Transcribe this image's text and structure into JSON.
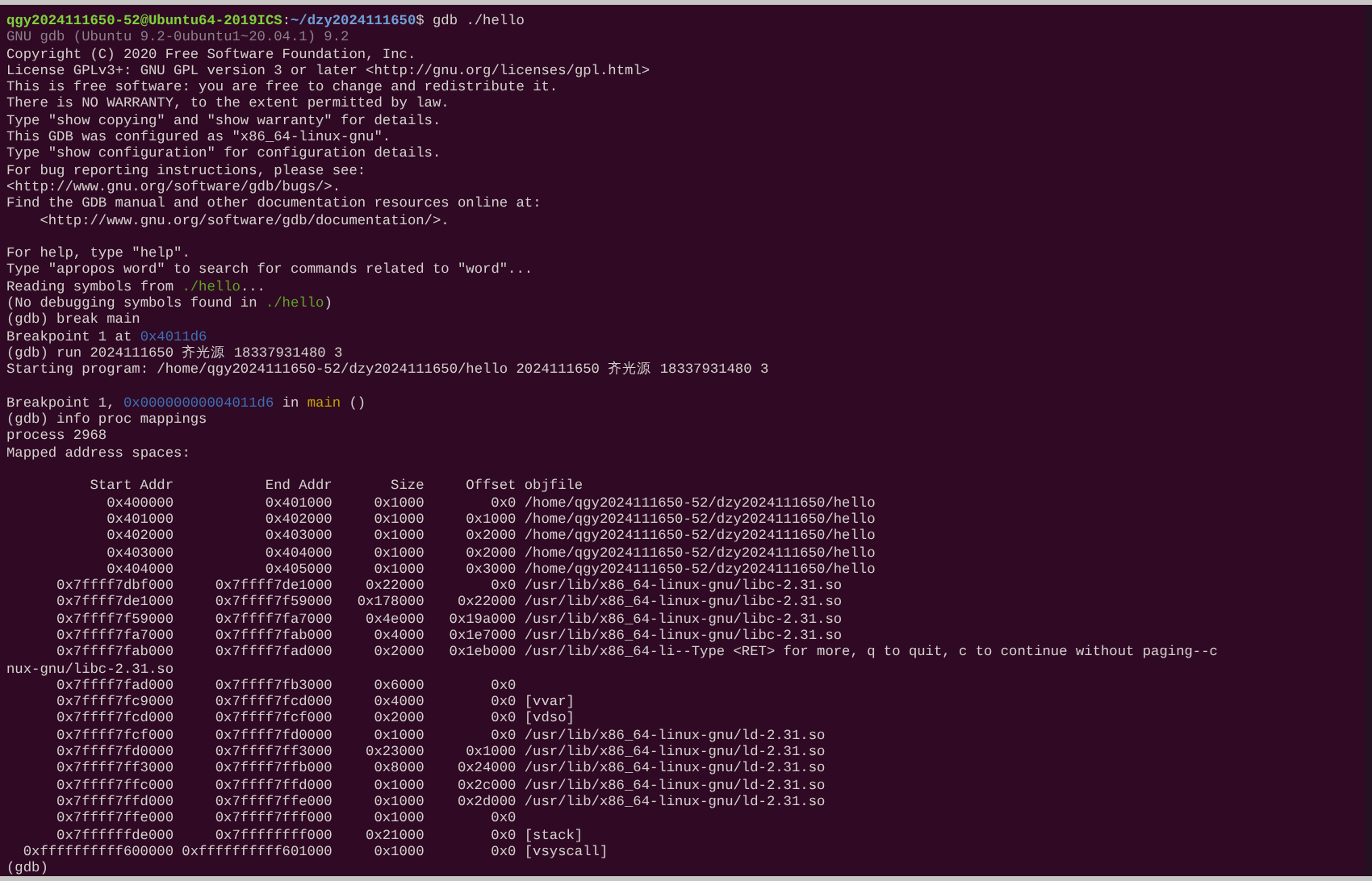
{
  "terminal": {
    "lines": [
      {
        "kind": "text",
        "segments": [
          {
            "kind": "user",
            "text": "qgy2024111650-52@Ubuntu64-2019ICS"
          },
          {
            "kind": "plain",
            "text": ":"
          },
          {
            "kind": "path",
            "text": "~/dzy2024111650"
          },
          {
            "kind": "plain",
            "text": "$ gdb ./hello"
          }
        ]
      },
      {
        "kind": "text",
        "segments": [
          {
            "kind": "dim",
            "text": "GNU gdb (Ubuntu 9.2-0ubuntu1~20.04.1) 9.2"
          }
        ]
      },
      {
        "kind": "text",
        "segments": [
          {
            "kind": "plain",
            "text": "Copyright (C) 2020 Free Software Foundation, Inc."
          }
        ]
      },
      {
        "kind": "text",
        "segments": [
          {
            "kind": "plain",
            "text": "License GPLv3+: GNU GPL version 3 or later <http://gnu.org/licenses/gpl.html>"
          }
        ]
      },
      {
        "kind": "text",
        "segments": [
          {
            "kind": "plain",
            "text": "This is free software: you are free to change and redistribute it."
          }
        ]
      },
      {
        "kind": "text",
        "segments": [
          {
            "kind": "plain",
            "text": "There is NO WARRANTY, to the extent permitted by law."
          }
        ]
      },
      {
        "kind": "text",
        "segments": [
          {
            "kind": "plain",
            "text": "Type \"show copying\" and \"show warranty\" for details."
          }
        ]
      },
      {
        "kind": "text",
        "segments": [
          {
            "kind": "plain",
            "text": "This GDB was configured as \"x86_64-linux-gnu\"."
          }
        ]
      },
      {
        "kind": "text",
        "segments": [
          {
            "kind": "plain",
            "text": "Type \"show configuration\" for configuration details."
          }
        ]
      },
      {
        "kind": "text",
        "segments": [
          {
            "kind": "plain",
            "text": "For bug reporting instructions, please see:"
          }
        ]
      },
      {
        "kind": "text",
        "segments": [
          {
            "kind": "plain",
            "text": "<http://www.gnu.org/software/gdb/bugs/>."
          }
        ]
      },
      {
        "kind": "text",
        "segments": [
          {
            "kind": "plain",
            "text": "Find the GDB manual and other documentation resources online at:"
          }
        ]
      },
      {
        "kind": "text",
        "segments": [
          {
            "kind": "plain",
            "text": "    <http://www.gnu.org/software/gdb/documentation/>."
          }
        ]
      },
      {
        "kind": "blank"
      },
      {
        "kind": "text",
        "segments": [
          {
            "kind": "plain",
            "text": "For help, type \"help\"."
          }
        ]
      },
      {
        "kind": "text",
        "segments": [
          {
            "kind": "plain",
            "text": "Type \"apropos word\" to search for commands related to \"word\"..."
          }
        ]
      },
      {
        "kind": "text",
        "segments": [
          {
            "kind": "plain",
            "text": "Reading symbols from "
          },
          {
            "kind": "file",
            "text": "./hello"
          },
          {
            "kind": "plain",
            "text": "..."
          }
        ]
      },
      {
        "kind": "text",
        "segments": [
          {
            "kind": "plain",
            "text": "(No debugging symbols found in "
          },
          {
            "kind": "file",
            "text": "./hello"
          },
          {
            "kind": "plain",
            "text": ")"
          }
        ]
      },
      {
        "kind": "text",
        "segments": [
          {
            "kind": "plain",
            "text": "(gdb) break main"
          }
        ]
      },
      {
        "kind": "text",
        "segments": [
          {
            "kind": "plain",
            "text": "Breakpoint 1 at "
          },
          {
            "kind": "address",
            "text": "0x4011d6"
          }
        ]
      },
      {
        "kind": "text",
        "segments": [
          {
            "kind": "plain",
            "text": "(gdb) run 2024111650 齐光源 18337931480 3"
          }
        ]
      },
      {
        "kind": "text",
        "segments": [
          {
            "kind": "plain",
            "text": "Starting program: /home/qgy2024111650-52/dzy2024111650/hello 2024111650 齐光源 18337931480 3"
          }
        ]
      },
      {
        "kind": "blank"
      },
      {
        "kind": "text",
        "segments": [
          {
            "kind": "plain",
            "text": "Breakpoint 1, "
          },
          {
            "kind": "address",
            "text": "0x00000000004011d6"
          },
          {
            "kind": "plain",
            "text": " in "
          },
          {
            "kind": "function",
            "text": "main"
          },
          {
            "kind": "plain",
            "text": " ()"
          }
        ]
      },
      {
        "kind": "text",
        "segments": [
          {
            "kind": "plain",
            "text": "(gdb) info proc mappings"
          }
        ]
      },
      {
        "kind": "text",
        "segments": [
          {
            "kind": "plain",
            "text": "process 2968"
          }
        ]
      },
      {
        "kind": "text",
        "segments": [
          {
            "kind": "plain",
            "text": "Mapped address spaces:"
          }
        ]
      },
      {
        "kind": "blank"
      },
      {
        "kind": "header",
        "cells": [
          "Start Addr",
          "End Addr",
          "Size",
          "Offset",
          "objfile"
        ]
      },
      {
        "kind": "row",
        "cells": [
          "0x400000",
          "0x401000",
          "0x1000",
          "0x0",
          "/home/qgy2024111650-52/dzy2024111650/hello"
        ]
      },
      {
        "kind": "row",
        "cells": [
          "0x401000",
          "0x402000",
          "0x1000",
          "0x1000",
          "/home/qgy2024111650-52/dzy2024111650/hello"
        ]
      },
      {
        "kind": "row",
        "cells": [
          "0x402000",
          "0x403000",
          "0x1000",
          "0x2000",
          "/home/qgy2024111650-52/dzy2024111650/hello"
        ]
      },
      {
        "kind": "row",
        "cells": [
          "0x403000",
          "0x404000",
          "0x1000",
          "0x2000",
          "/home/qgy2024111650-52/dzy2024111650/hello"
        ]
      },
      {
        "kind": "row",
        "cells": [
          "0x404000",
          "0x405000",
          "0x1000",
          "0x3000",
          "/home/qgy2024111650-52/dzy2024111650/hello"
        ]
      },
      {
        "kind": "row",
        "cells": [
          "0x7ffff7dbf000",
          "0x7ffff7de1000",
          "0x22000",
          "0x0",
          "/usr/lib/x86_64-linux-gnu/libc-2.31.so"
        ]
      },
      {
        "kind": "row",
        "cells": [
          "0x7ffff7de1000",
          "0x7ffff7f59000",
          "0x178000",
          "0x22000",
          "/usr/lib/x86_64-linux-gnu/libc-2.31.so"
        ]
      },
      {
        "kind": "row",
        "cells": [
          "0x7ffff7f59000",
          "0x7ffff7fa7000",
          "0x4e000",
          "0x19a000",
          "/usr/lib/x86_64-linux-gnu/libc-2.31.so"
        ]
      },
      {
        "kind": "row",
        "cells": [
          "0x7ffff7fa7000",
          "0x7ffff7fab000",
          "0x4000",
          "0x1e7000",
          "/usr/lib/x86_64-linux-gnu/libc-2.31.so"
        ]
      },
      {
        "kind": "row",
        "cells": [
          "0x7ffff7fab000",
          "0x7ffff7fad000",
          "0x2000",
          "0x1eb000",
          "/usr/lib/x86_64-li--Type <RET> for more, q to quit, c to continue without paging--c"
        ]
      },
      {
        "kind": "text",
        "segments": [
          {
            "kind": "plain",
            "text": "nux-gnu/libc-2.31.so"
          }
        ]
      },
      {
        "kind": "row",
        "cells": [
          "0x7ffff7fad000",
          "0x7ffff7fb3000",
          "0x6000",
          "0x0"
        ]
      },
      {
        "kind": "row",
        "cells": [
          "0x7ffff7fc9000",
          "0x7ffff7fcd000",
          "0x4000",
          "0x0",
          "[vvar]"
        ]
      },
      {
        "kind": "row",
        "cells": [
          "0x7ffff7fcd000",
          "0x7ffff7fcf000",
          "0x2000",
          "0x0",
          "[vdso]"
        ]
      },
      {
        "kind": "row",
        "cells": [
          "0x7ffff7fcf000",
          "0x7ffff7fd0000",
          "0x1000",
          "0x0",
          "/usr/lib/x86_64-linux-gnu/ld-2.31.so"
        ]
      },
      {
        "kind": "row",
        "cells": [
          "0x7ffff7fd0000",
          "0x7ffff7ff3000",
          "0x23000",
          "0x1000",
          "/usr/lib/x86_64-linux-gnu/ld-2.31.so"
        ]
      },
      {
        "kind": "row",
        "cells": [
          "0x7ffff7ff3000",
          "0x7ffff7ffb000",
          "0x8000",
          "0x24000",
          "/usr/lib/x86_64-linux-gnu/ld-2.31.so"
        ]
      },
      {
        "kind": "row",
        "cells": [
          "0x7ffff7ffc000",
          "0x7ffff7ffd000",
          "0x1000",
          "0x2c000",
          "/usr/lib/x86_64-linux-gnu/ld-2.31.so"
        ]
      },
      {
        "kind": "row",
        "cells": [
          "0x7ffff7ffd000",
          "0x7ffff7ffe000",
          "0x1000",
          "0x2d000",
          "/usr/lib/x86_64-linux-gnu/ld-2.31.so"
        ]
      },
      {
        "kind": "row",
        "cells": [
          "0x7ffff7ffe000",
          "0x7ffff7fff000",
          "0x1000",
          "0x0"
        ]
      },
      {
        "kind": "row",
        "cells": [
          "0x7ffffffde000",
          "0x7ffffffff000",
          "0x21000",
          "0x0",
          "[stack]"
        ]
      },
      {
        "kind": "row",
        "cells": [
          "0xffffffffff600000",
          "0xffffffffff601000",
          "0x1000",
          "0x0",
          "[vsyscall]"
        ]
      },
      {
        "kind": "text",
        "segments": [
          {
            "kind": "plain",
            "text": "(gdb)"
          }
        ]
      }
    ]
  }
}
